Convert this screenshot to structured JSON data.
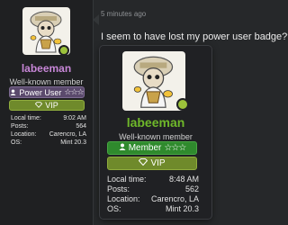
{
  "timestamp": "5 minutes ago",
  "message": "I seem to have lost my power user badge???",
  "colors": {
    "username_small": "#c786d7",
    "username_card": "#6fb82a",
    "power_user_badge": "#5b4a6d",
    "member_badge": "#2f8a2d",
    "vip_badge": "#6f8a2b"
  },
  "sidebar": {
    "avatar_icon": "bee-avatar",
    "username": "labeeman",
    "title": "Well-known member",
    "badge_primary": {
      "label": "Power User",
      "stars": "☆☆☆"
    },
    "badge_vip": {
      "label": "VIP",
      "icon": "vip-icon"
    },
    "stats": [
      {
        "label": "Local time:",
        "value": "9:02 AM"
      },
      {
        "label": "Posts:",
        "value": "564"
      },
      {
        "label": "Location:",
        "value": "Carencro, LA"
      },
      {
        "label": "OS:",
        "value": "Mint 20.3"
      }
    ]
  },
  "card": {
    "avatar_icon": "bee-avatar",
    "username": "labeeman",
    "title": "Well-known member",
    "badge_primary": {
      "label": "Member",
      "stars": "☆☆☆"
    },
    "badge_vip": {
      "label": "VIP",
      "icon": "vip-icon"
    },
    "stats": [
      {
        "label": "Local time:",
        "value": "8:48 AM"
      },
      {
        "label": "Posts:",
        "value": "562"
      },
      {
        "label": "Location:",
        "value": "Carencro, LA"
      },
      {
        "label": "OS:",
        "value": "Mint 20.3"
      }
    ]
  }
}
